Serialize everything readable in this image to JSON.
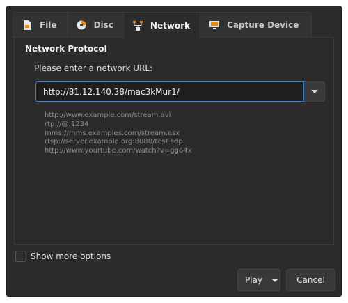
{
  "tabs": [
    {
      "label": "File",
      "icon": "file-icon"
    },
    {
      "label": "Disc",
      "icon": "disc-icon"
    },
    {
      "label": "Network",
      "icon": "network-icon",
      "active": true
    },
    {
      "label": "Capture Device",
      "icon": "capture-device-icon"
    }
  ],
  "group": {
    "title": "Network Protocol"
  },
  "url": {
    "label": "Please enter a network URL:",
    "value": "http://81.12.140.38/mac3kMur1/"
  },
  "examples": [
    "http://www.example.com/stream.avi",
    "rtp://@:1234",
    "mms://mms.examples.com/stream.asx",
    "rtsp://server.example.org:8080/test.sdp",
    "http://www.yourtube.com/watch?v=gg64x"
  ],
  "options": {
    "show_more_label": "Show more options",
    "show_more_checked": false
  },
  "buttons": {
    "play": "Play",
    "cancel": "Cancel"
  },
  "colors": {
    "background": "#2b2b2b",
    "accent": "#3584e4"
  }
}
